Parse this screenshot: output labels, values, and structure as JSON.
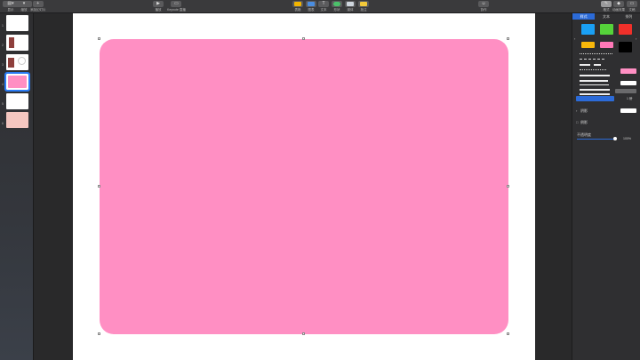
{
  "toolbar": {
    "left": [
      {
        "label": "显示",
        "icon": "view-icon"
      },
      {
        "label": "缩放",
        "icon": "zoom-icon"
      },
      {
        "label": "添加幻灯片",
        "icon": "add-slide-icon"
      }
    ],
    "center": [
      {
        "label": "播放",
        "icon": "play-icon"
      },
      {
        "label": "Keynote 直播",
        "icon": "keynote-live-icon"
      }
    ],
    "insert": [
      {
        "label": "表格",
        "icon": "table-icon"
      },
      {
        "label": "图表",
        "icon": "chart-icon"
      },
      {
        "label": "文本",
        "icon": "text-icon"
      },
      {
        "label": "形状",
        "icon": "shape-icon"
      },
      {
        "label": "媒体",
        "icon": "media-icon"
      },
      {
        "label": "批注",
        "icon": "comment-icon"
      }
    ],
    "collab": {
      "label": "协作",
      "icon": "collaborate-icon"
    },
    "right": [
      {
        "label": "格式",
        "icon": "format-icon"
      },
      {
        "label": "动画效果",
        "icon": "animate-icon"
      },
      {
        "label": "文稿",
        "icon": "document-icon"
      }
    ]
  },
  "slides": [
    {
      "num": "1"
    },
    {
      "num": "2"
    },
    {
      "num": "3"
    },
    {
      "num": "4"
    },
    {
      "num": "5"
    },
    {
      "num": "6"
    }
  ],
  "inspector": {
    "tabs": [
      "样式",
      "文本",
      "排列"
    ],
    "active_tab": "样式",
    "style_colors": [
      "#1aa0f5",
      "#55d23a",
      "#f0302a",
      "#f9b80a",
      "#ff78b8",
      "#000000"
    ],
    "fill_color": "#ff8fc3",
    "shape_color": "#ff8fc3",
    "shadow_label": "阴影",
    "reflection_label": "倒影",
    "opacity_label": "不透明度",
    "opacity_value": "100%",
    "line_value": "1 磅"
  }
}
